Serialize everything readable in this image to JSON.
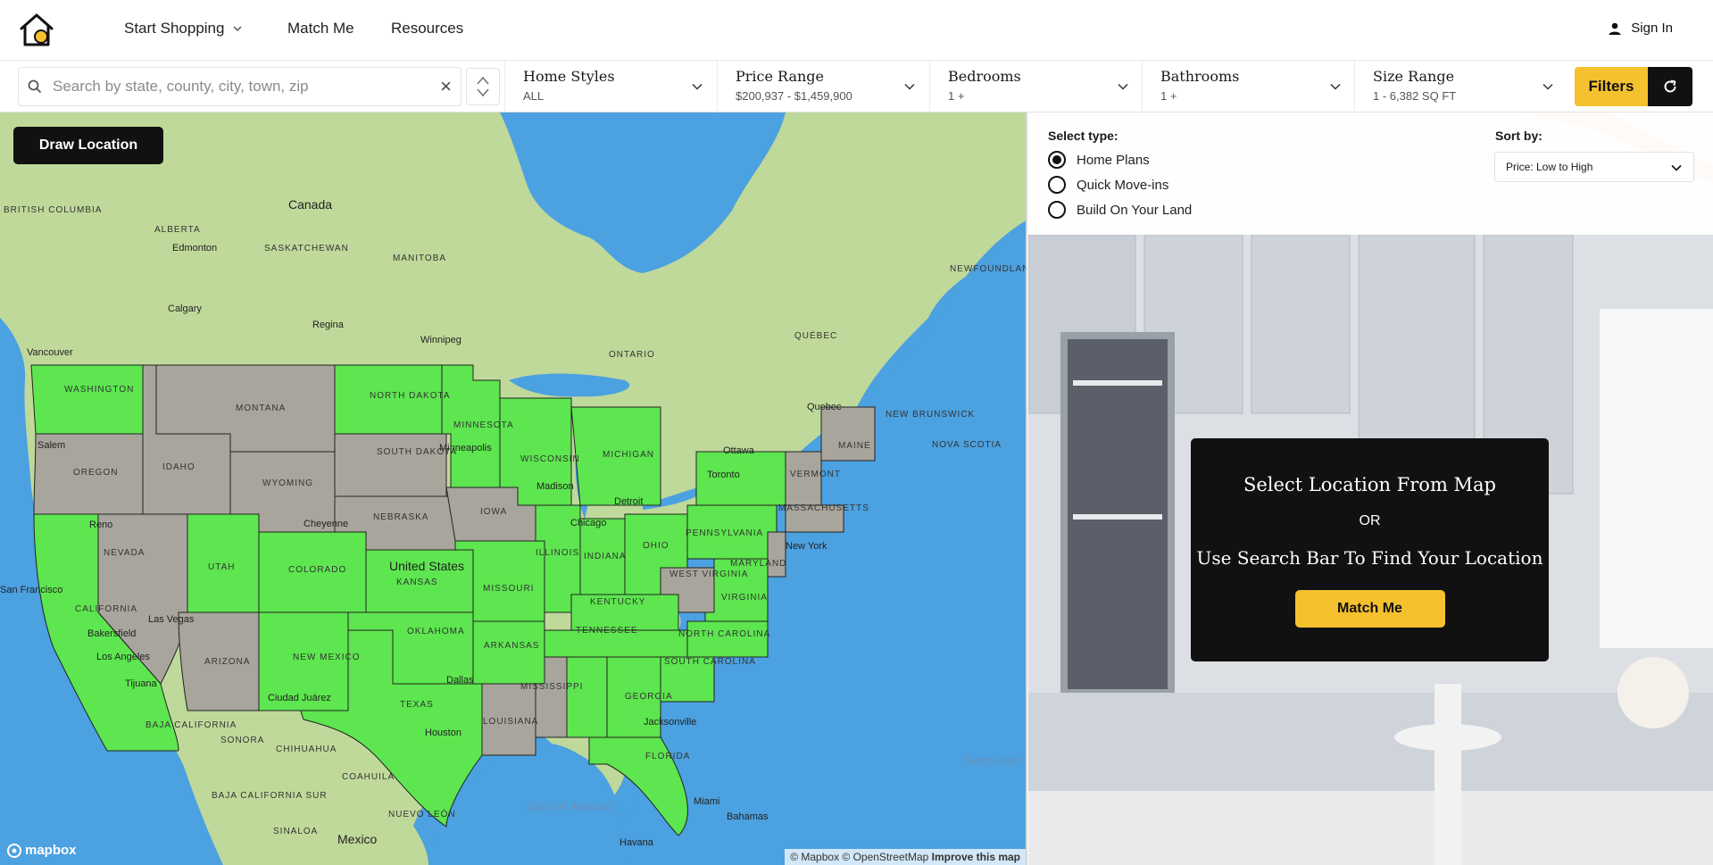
{
  "nav": {
    "start_shopping": "Start Shopping",
    "match_me": "Match Me",
    "resources": "Resources",
    "sign_in": "Sign In"
  },
  "search": {
    "placeholder": "Search by state, county, city, town, zip",
    "clear": "×"
  },
  "filters": [
    {
      "title": "Home Styles",
      "value": "ALL"
    },
    {
      "title": "Price Range",
      "value": "$200,937 - $1,459,900"
    },
    {
      "title": "Bedrooms",
      "value": "1 +"
    },
    {
      "title": "Bathrooms",
      "value": "1 +"
    },
    {
      "title": "Size Range",
      "value": "1 - 6,382 SQ FT"
    }
  ],
  "filters_button": "Filters",
  "map": {
    "draw_location": "Draw Location",
    "labels": {
      "canada": "Canada",
      "united_states": "United States",
      "mexico": "Mexico",
      "british_columbia": "BRITISH COLUMBIA",
      "alberta": "ALBERTA",
      "saskatchewan": "SASKATCHEWAN",
      "manitoba": "MANITOBA",
      "ontario": "ONTARIO",
      "quebec": "QUÉBEC",
      "newfoundland": "NEWFOUNDLAND AND LABRADOR",
      "new_brunswick": "NEW BRUNSWICK",
      "nova_scotia": "NOVA SCOTIA",
      "washington": "WASHINGTON",
      "montana": "MONTANA",
      "north_dakota": "NORTH DAKOTA",
      "south_dakota": "SOUTH DAKOTA",
      "minnesota": "MINNESOTA",
      "oregon": "OREGON",
      "idaho": "IDAHO",
      "wyoming": "WYOMING",
      "nebraska": "NEBRASKA",
      "iowa": "IOWA",
      "wisconsin": "WISCONSIN",
      "michigan": "MICHIGAN",
      "illinois": "ILLINOIS",
      "indiana": "INDIANA",
      "ohio": "OHIO",
      "pennsylvania": "PENNSYLVANIA",
      "nevada": "NEVADA",
      "utah": "UTAH",
      "colorado": "COLORADO",
      "kansas": "KANSAS",
      "missouri": "MISSOURI",
      "kentucky": "KENTUCKY",
      "virginia": "VIRGINIA",
      "west_virginia": "WEST VIRGINIA",
      "california": "CALIFORNIA",
      "arizona": "ARIZONA",
      "new_mexico": "NEW MEXICO",
      "oklahoma": "OKLAHOMA",
      "arkansas": "ARKANSAS",
      "tennessee": "TENNESSEE",
      "north_carolina": "NORTH CAROLINA",
      "south_carolina": "SOUTH CAROLINA",
      "texas": "TEXAS",
      "louisiana": "LOUISIANA",
      "mississippi": "MISSISSIPPI",
      "georgia": "GEORGIA",
      "florida": "FLORIDA",
      "maine": "MAINE",
      "vermont": "VERMONT",
      "massachusetts": "MASSACHUSETTS",
      "maryland": "MARYLAND",
      "sonora": "SONORA",
      "chihuahua": "CHIHUAHUA",
      "coahuila": "COAHUILA",
      "nuevo_leon": "NUEVO LEÓN",
      "sinaloa": "SINALOA",
      "baja_california": "BAJA CALIFORNIA",
      "baja_california_sur": "BAJA CALIFORNIA SUR",
      "gulf_of_mexico": "Gulf of Mexico",
      "sargasso_sea": "Sargasso Sea",
      "edmonton": "Edmonton",
      "calgary": "Calgary",
      "vancouver": "Vancouver",
      "regina": "Regina",
      "winnipeg": "Winnipeg",
      "quebec_city": "Quebec",
      "ottawa": "Ottawa",
      "toronto": "Toronto",
      "detroit": "Detroit",
      "chicago": "Chicago",
      "minneapolis": "Minneapolis",
      "madison": "Madison",
      "new_york": "New York",
      "salem": "Salem",
      "reno": "Reno",
      "cheyenne": "Cheyenne",
      "san_francisco": "San Francisco",
      "bakersfield": "Bakersfield",
      "los_angeles": "Los Angeles",
      "tijuana": "Tijuana",
      "las_vegas": "Las Vegas",
      "ciudad_juarez": "Ciudad Juárez",
      "dallas": "Dallas",
      "houston": "Houston",
      "jacksonville": "Jacksonville",
      "miami": "Miami",
      "havana": "Havana",
      "bahamas": "Bahamas"
    },
    "mapbox": "mapbox",
    "attribution": "© Mapbox © OpenStreetMap",
    "improve": "Improve this map"
  },
  "panel": {
    "select_type_label": "Select type:",
    "types": [
      "Home Plans",
      "Quick Move-ins",
      "Build On Your Land"
    ],
    "selected_type": "Home Plans",
    "sort_label": "Sort by:",
    "sort_value": "Price: Low to High",
    "select_location": "Select Location From Map",
    "or": "OR",
    "use_search": "Use Search Bar To Find Your Location",
    "match_me": "Match Me"
  },
  "colors": {
    "accent": "#f6c12e",
    "dark": "#111111",
    "land": "#bfd99a",
    "water": "#4ca1e0",
    "state_green": "#5de64f",
    "state_gray": "#a8a59c"
  }
}
